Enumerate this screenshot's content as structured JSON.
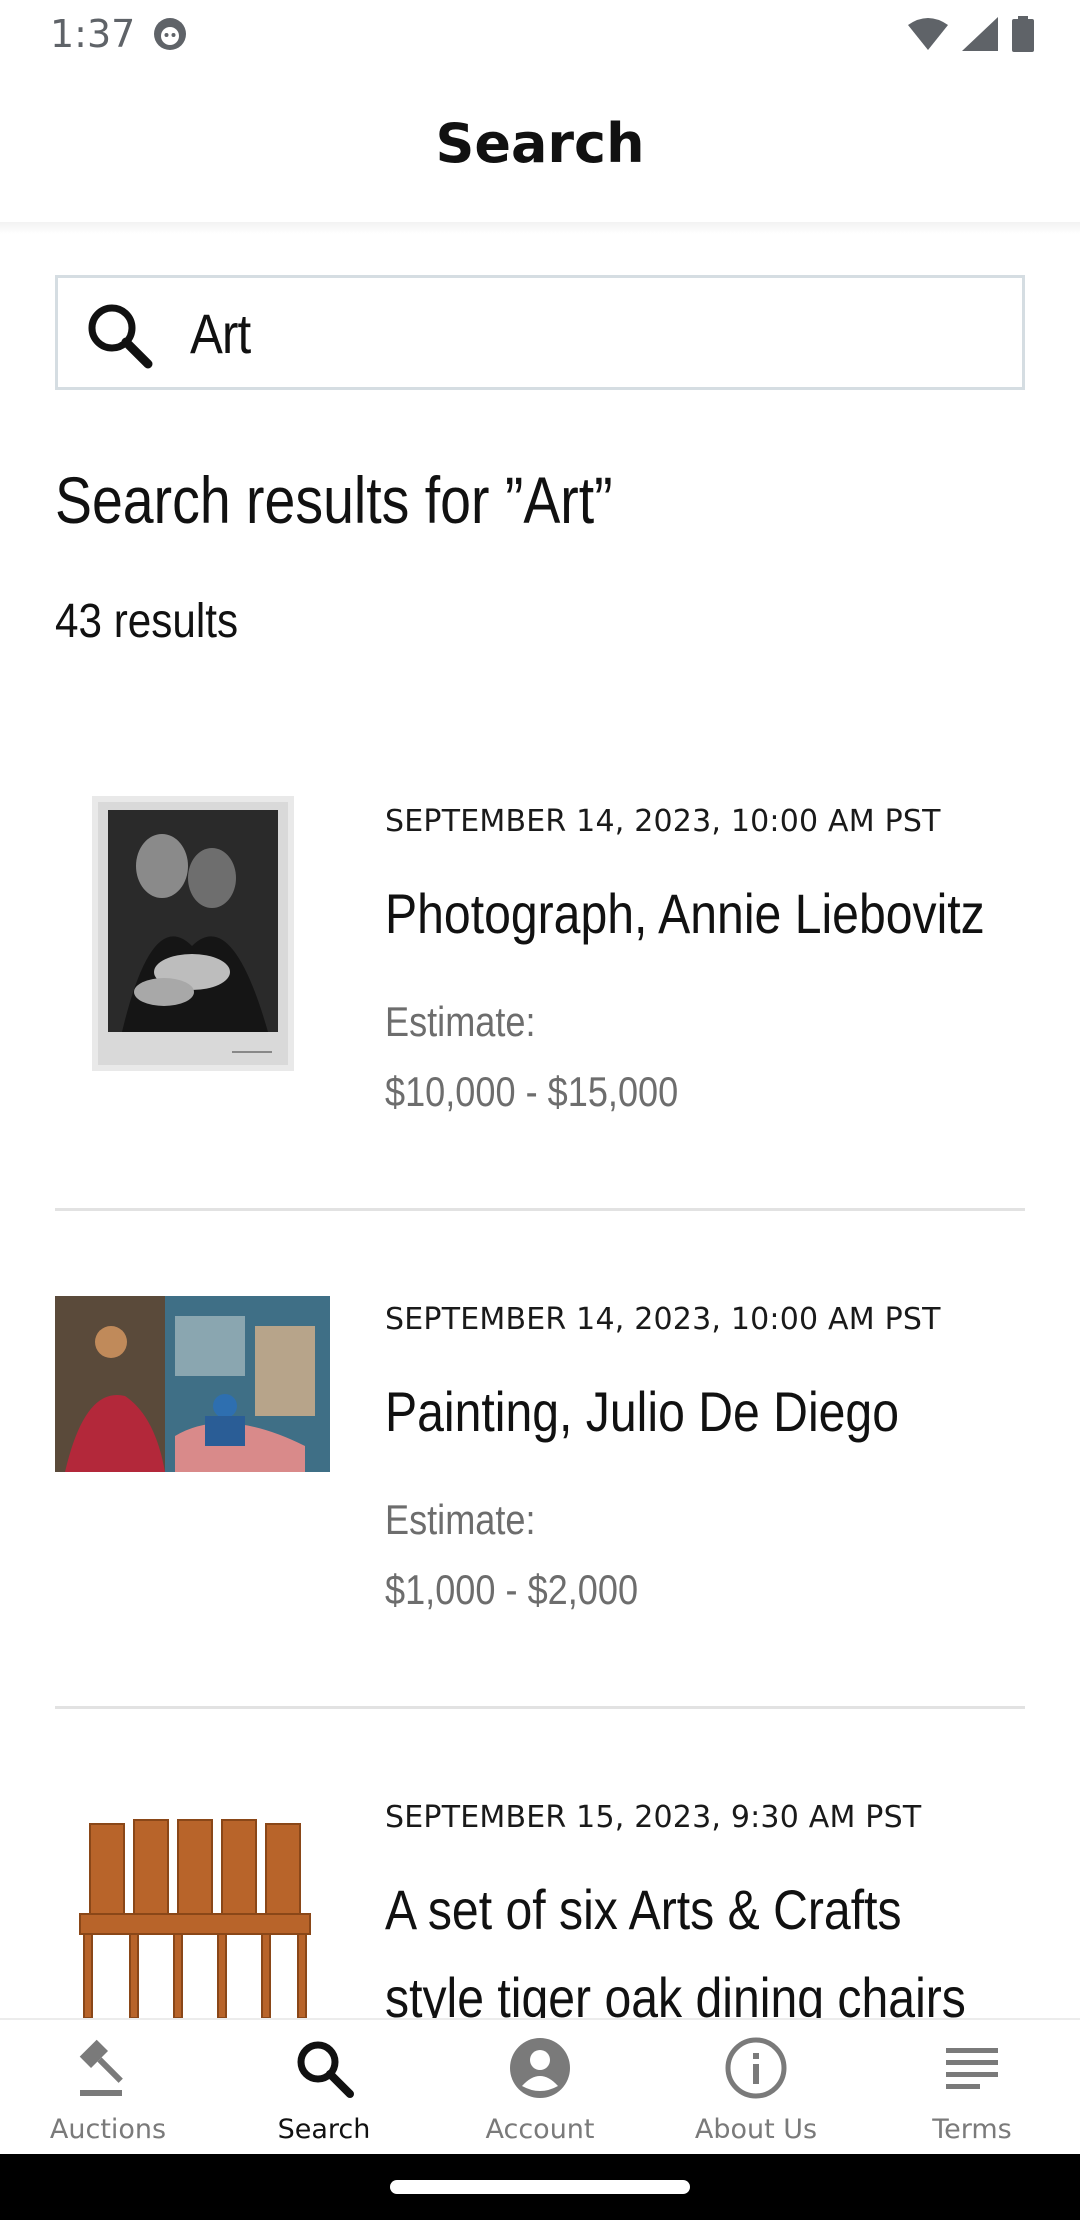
{
  "status_bar": {
    "time": "1:37"
  },
  "app_bar": {
    "title": "Search"
  },
  "search": {
    "value": "Art"
  },
  "results": {
    "heading": "Search results for ”Art”",
    "count_label": "43 results",
    "items": [
      {
        "date": "SEPTEMBER 14, 2023, 10:00 AM PST",
        "title": "Photograph, Annie Liebovitz",
        "estimate_label": "Estimate:",
        "estimate_value": "$10,000 - $15,000"
      },
      {
        "date": "SEPTEMBER 14, 2023, 10:00 AM PST",
        "title": "Painting, Julio De Diego",
        "estimate_label": "Estimate:",
        "estimate_value": "$1,000 - $2,000"
      },
      {
        "date": "SEPTEMBER 15, 2023, 9:30 AM PST",
        "title_line1": "A set of six Arts & Crafts",
        "title_line2": "style tiger oak dining chairs"
      }
    ]
  },
  "bottom_nav": {
    "items": [
      {
        "label": "Auctions",
        "icon": "gavel-icon",
        "active": false
      },
      {
        "label": "Search",
        "icon": "search-icon",
        "active": true
      },
      {
        "label": "Account",
        "icon": "account-icon",
        "active": false
      },
      {
        "label": "About Us",
        "icon": "info-icon",
        "active": false
      },
      {
        "label": "Terms",
        "icon": "terms-icon",
        "active": false
      }
    ]
  },
  "colors": {
    "text": "#111111",
    "muted": "#6d6d6d",
    "nav_inactive": "#7a7a7a",
    "divider": "#e2e2e2",
    "input_border": "#d5dde2"
  }
}
